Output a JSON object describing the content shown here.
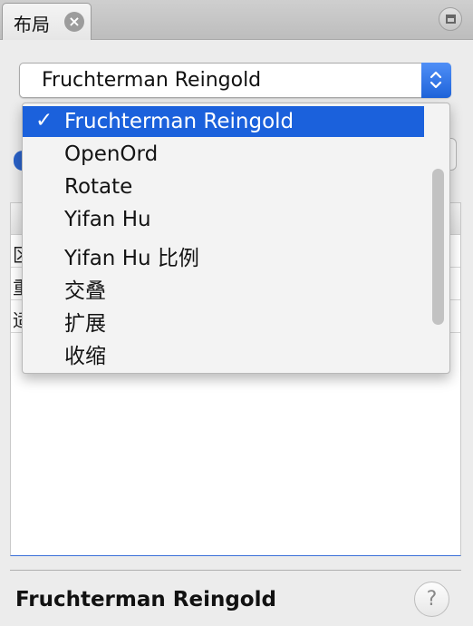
{
  "tab": {
    "title": "布局",
    "close_icon": "close-icon"
  },
  "window": {
    "restore_icon": "window-restore-icon"
  },
  "layout_select": {
    "selected_value": "Fruchterman Reingold",
    "check_mark": "✓",
    "options": [
      "Fruchterman Reingold",
      "OpenOrd",
      "Rotate",
      "Yifan Hu",
      "Yifan Hu 比例",
      "交叠",
      "扩展",
      "收缩"
    ]
  },
  "properties": {
    "rows": [
      "区",
      "重",
      "适"
    ]
  },
  "footer": {
    "title": "Fruchterman Reingold",
    "help_label": "?"
  },
  "colors": {
    "accent": "#1b61dc",
    "tab_bar": "#c6c6c6",
    "panel_bg": "#ececec"
  }
}
